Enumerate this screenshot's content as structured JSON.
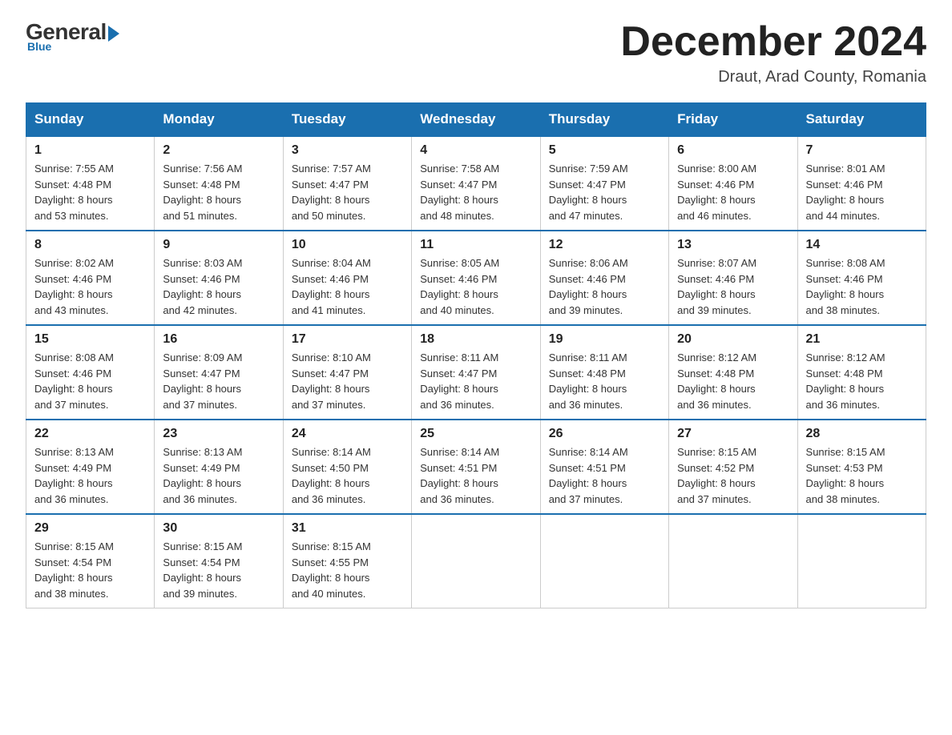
{
  "header": {
    "logo_general": "General",
    "logo_blue": "Blue",
    "month_title": "December 2024",
    "location": "Draut, Arad County, Romania"
  },
  "days_of_week": [
    "Sunday",
    "Monday",
    "Tuesday",
    "Wednesday",
    "Thursday",
    "Friday",
    "Saturday"
  ],
  "weeks": [
    [
      {
        "day": "1",
        "sunrise": "7:55 AM",
        "sunset": "4:48 PM",
        "daylight": "8 hours and 53 minutes."
      },
      {
        "day": "2",
        "sunrise": "7:56 AM",
        "sunset": "4:48 PM",
        "daylight": "8 hours and 51 minutes."
      },
      {
        "day": "3",
        "sunrise": "7:57 AM",
        "sunset": "4:47 PM",
        "daylight": "8 hours and 50 minutes."
      },
      {
        "day": "4",
        "sunrise": "7:58 AM",
        "sunset": "4:47 PM",
        "daylight": "8 hours and 48 minutes."
      },
      {
        "day": "5",
        "sunrise": "7:59 AM",
        "sunset": "4:47 PM",
        "daylight": "8 hours and 47 minutes."
      },
      {
        "day": "6",
        "sunrise": "8:00 AM",
        "sunset": "4:46 PM",
        "daylight": "8 hours and 46 minutes."
      },
      {
        "day": "7",
        "sunrise": "8:01 AM",
        "sunset": "4:46 PM",
        "daylight": "8 hours and 44 minutes."
      }
    ],
    [
      {
        "day": "8",
        "sunrise": "8:02 AM",
        "sunset": "4:46 PM",
        "daylight": "8 hours and 43 minutes."
      },
      {
        "day": "9",
        "sunrise": "8:03 AM",
        "sunset": "4:46 PM",
        "daylight": "8 hours and 42 minutes."
      },
      {
        "day": "10",
        "sunrise": "8:04 AM",
        "sunset": "4:46 PM",
        "daylight": "8 hours and 41 minutes."
      },
      {
        "day": "11",
        "sunrise": "8:05 AM",
        "sunset": "4:46 PM",
        "daylight": "8 hours and 40 minutes."
      },
      {
        "day": "12",
        "sunrise": "8:06 AM",
        "sunset": "4:46 PM",
        "daylight": "8 hours and 39 minutes."
      },
      {
        "day": "13",
        "sunrise": "8:07 AM",
        "sunset": "4:46 PM",
        "daylight": "8 hours and 39 minutes."
      },
      {
        "day": "14",
        "sunrise": "8:08 AM",
        "sunset": "4:46 PM",
        "daylight": "8 hours and 38 minutes."
      }
    ],
    [
      {
        "day": "15",
        "sunrise": "8:08 AM",
        "sunset": "4:46 PM",
        "daylight": "8 hours and 37 minutes."
      },
      {
        "day": "16",
        "sunrise": "8:09 AM",
        "sunset": "4:47 PM",
        "daylight": "8 hours and 37 minutes."
      },
      {
        "day": "17",
        "sunrise": "8:10 AM",
        "sunset": "4:47 PM",
        "daylight": "8 hours and 37 minutes."
      },
      {
        "day": "18",
        "sunrise": "8:11 AM",
        "sunset": "4:47 PM",
        "daylight": "8 hours and 36 minutes."
      },
      {
        "day": "19",
        "sunrise": "8:11 AM",
        "sunset": "4:48 PM",
        "daylight": "8 hours and 36 minutes."
      },
      {
        "day": "20",
        "sunrise": "8:12 AM",
        "sunset": "4:48 PM",
        "daylight": "8 hours and 36 minutes."
      },
      {
        "day": "21",
        "sunrise": "8:12 AM",
        "sunset": "4:48 PM",
        "daylight": "8 hours and 36 minutes."
      }
    ],
    [
      {
        "day": "22",
        "sunrise": "8:13 AM",
        "sunset": "4:49 PM",
        "daylight": "8 hours and 36 minutes."
      },
      {
        "day": "23",
        "sunrise": "8:13 AM",
        "sunset": "4:49 PM",
        "daylight": "8 hours and 36 minutes."
      },
      {
        "day": "24",
        "sunrise": "8:14 AM",
        "sunset": "4:50 PM",
        "daylight": "8 hours and 36 minutes."
      },
      {
        "day": "25",
        "sunrise": "8:14 AM",
        "sunset": "4:51 PM",
        "daylight": "8 hours and 36 minutes."
      },
      {
        "day": "26",
        "sunrise": "8:14 AM",
        "sunset": "4:51 PM",
        "daylight": "8 hours and 37 minutes."
      },
      {
        "day": "27",
        "sunrise": "8:15 AM",
        "sunset": "4:52 PM",
        "daylight": "8 hours and 37 minutes."
      },
      {
        "day": "28",
        "sunrise": "8:15 AM",
        "sunset": "4:53 PM",
        "daylight": "8 hours and 38 minutes."
      }
    ],
    [
      {
        "day": "29",
        "sunrise": "8:15 AM",
        "sunset": "4:54 PM",
        "daylight": "8 hours and 38 minutes."
      },
      {
        "day": "30",
        "sunrise": "8:15 AM",
        "sunset": "4:54 PM",
        "daylight": "8 hours and 39 minutes."
      },
      {
        "day": "31",
        "sunrise": "8:15 AM",
        "sunset": "4:55 PM",
        "daylight": "8 hours and 40 minutes."
      },
      null,
      null,
      null,
      null
    ]
  ],
  "labels": {
    "sunrise": "Sunrise: ",
    "sunset": "Sunset: ",
    "daylight": "Daylight: "
  }
}
